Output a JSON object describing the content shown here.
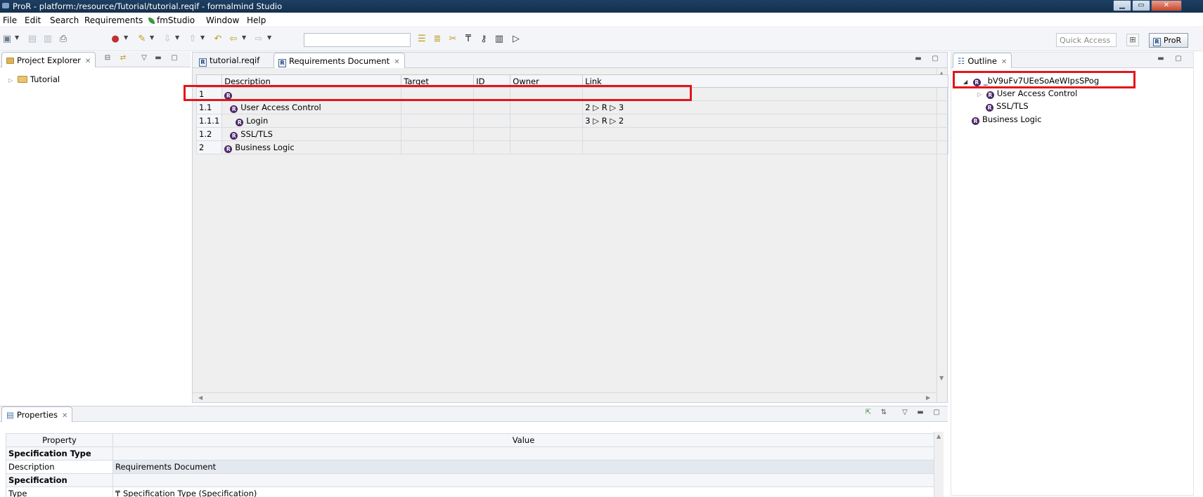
{
  "window": {
    "title": "ProR - platform:/resource/Tutorial/tutorial.reqif - formalmind Studio",
    "minimize": "▁",
    "maximize": "▭",
    "close": "✕"
  },
  "menu": [
    "File",
    "Edit",
    "Search",
    "Requirements",
    "fmStudio",
    "Window",
    "Help"
  ],
  "toolbar": {
    "icons": [
      "new-icon",
      "save-icon",
      "save-all-icon",
      "print-icon",
      "run-icon",
      "pen-icon",
      "import-icon",
      "export-icon",
      "back-icon",
      "prev-edit-icon",
      "forward-icon",
      "sort-icon",
      "filter-icon",
      "scissors-icon",
      "format-icon",
      "unlink-icon",
      "columns-icon",
      "play-icon"
    ],
    "search_value": "",
    "quick_access_placeholder": "Quick Access",
    "perspective_label": "ProR"
  },
  "project_explorer": {
    "tab_label": "Project Explorer",
    "tree": [
      {
        "label": "Tutorial",
        "icon": "folder-icon",
        "expanded": false
      }
    ]
  },
  "editor": {
    "tabs": [
      {
        "label": "tutorial.reqif",
        "active": false
      },
      {
        "label": "Requirements Document",
        "active": true
      }
    ],
    "columns": [
      "Description",
      "Target",
      "ID",
      "Owner",
      "Link"
    ],
    "rows": [
      {
        "num": "1",
        "description": "",
        "link": ""
      },
      {
        "num": "1.1",
        "description": "User Access Control",
        "link": "2 ▷ R ▷ 3"
      },
      {
        "num": "1.1.1",
        "description": "Login",
        "link": "3 ▷ R ▷ 2"
      },
      {
        "num": "1.2",
        "description": "SSL/TLS",
        "link": ""
      },
      {
        "num": "2",
        "description": "Business Logic",
        "link": ""
      }
    ]
  },
  "outline": {
    "tab_label": "Outline",
    "root": "_bV9uFv7UEeSoAeWIpsSPog",
    "children": [
      "User Access Control",
      "SSL/TLS"
    ],
    "sibling": "Business Logic"
  },
  "properties": {
    "tab_label": "Properties",
    "columns": [
      "Property",
      "Value"
    ],
    "rows": [
      {
        "property": "Specification Type",
        "value": "",
        "section": true
      },
      {
        "property": "Description",
        "value": "Requirements Document",
        "section": false
      },
      {
        "property": "Specification",
        "value": "",
        "section": true
      },
      {
        "property": "Type",
        "value": "Specification Type (Specification)",
        "section": false
      }
    ]
  },
  "colors": {
    "highlight_box": "#e3151b",
    "title_bar": "#1d3f63",
    "req_icon": "#4b2a69"
  }
}
